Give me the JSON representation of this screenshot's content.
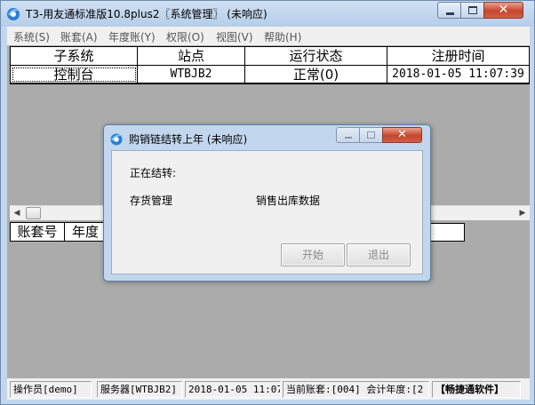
{
  "window": {
    "title": "T3-用友通标准版10.8plus2〖系统管理〗 (未响应)",
    "close_glyph": "✕"
  },
  "menubar": [
    "系统(S)",
    "账套(A)",
    "年度账(Y)",
    "权限(O)",
    "视图(V)",
    "帮助(H)"
  ],
  "grid_top": {
    "headers": [
      "子系统",
      "站点",
      "运行状态",
      "注册时间"
    ],
    "rows": [
      [
        "控制台",
        "WTBJB2",
        "正常(0)",
        "2018-01-05 11:07:39"
      ]
    ]
  },
  "grid_bottom": {
    "headers": [
      "账套号",
      "年度"
    ]
  },
  "statusbar": {
    "operator": "操作员[demo]",
    "server": "服务器[WTBJB2]",
    "datetime": "2018-01-05 11:07",
    "account": "当前账套:[004] 会计年度:[2",
    "brand": "【畅捷通软件】"
  },
  "dialog": {
    "title": "购销链结转上年 (未响应)",
    "status_label": "正在结转:",
    "module": "存货管理",
    "detail": "销售出库数据",
    "start_button": "开始",
    "exit_button": "退出",
    "close_glyph": "✕"
  },
  "colors": {
    "client_bg": "#ababab",
    "frame": "#c2d7ee",
    "close_red": "#c7452c"
  }
}
